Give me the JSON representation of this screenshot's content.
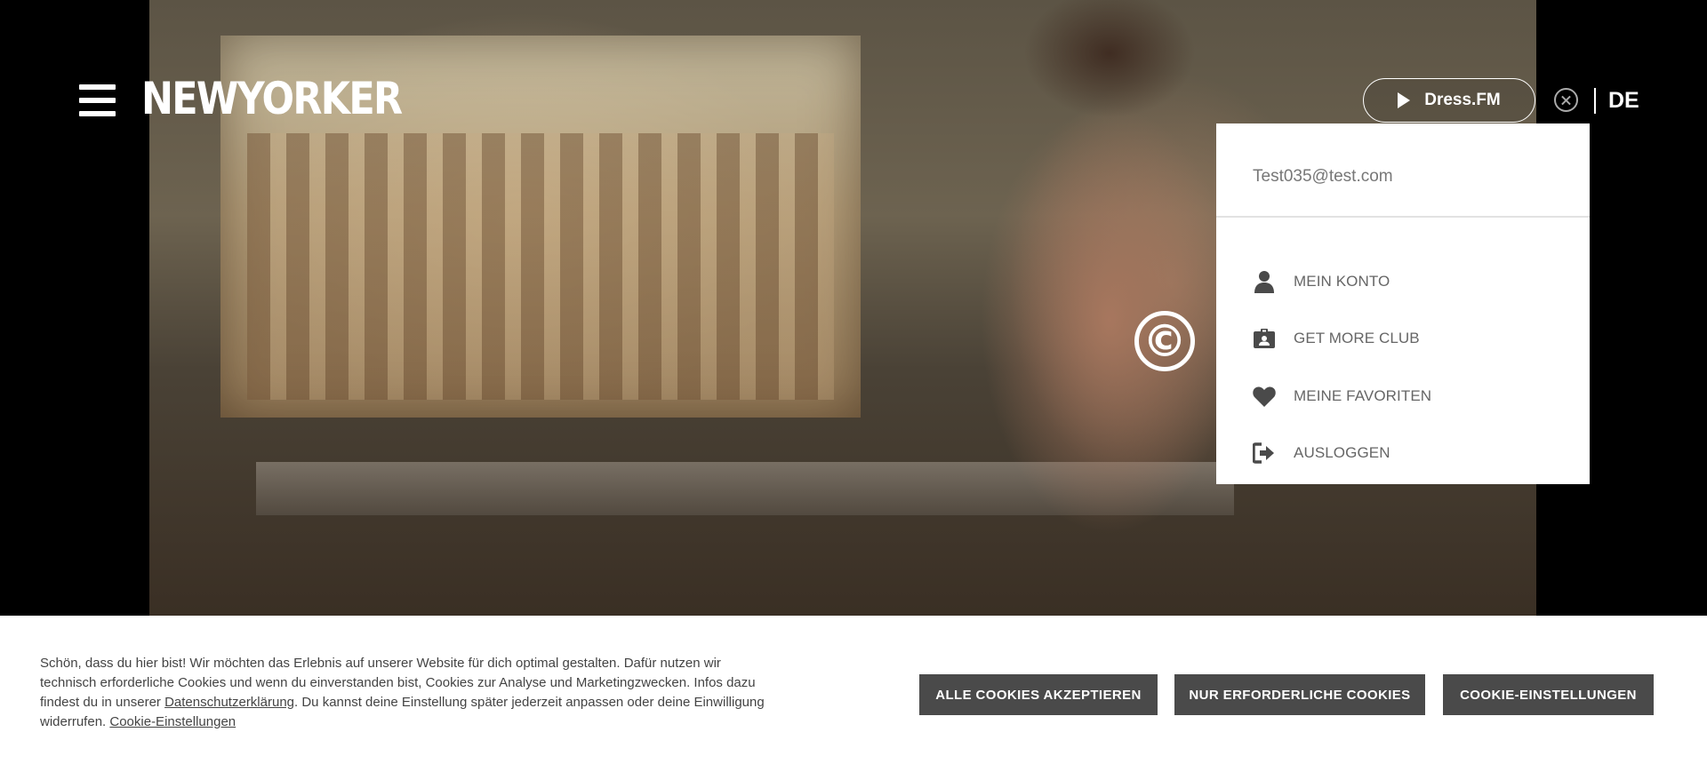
{
  "header": {
    "logo_text": "NEWYORKER",
    "dressfm_label": "Dress.FM",
    "language": "DE",
    "icons": {
      "menu": "hamburger-menu-icon",
      "play": "play-icon",
      "close": "close-circle-icon"
    }
  },
  "hero": {
    "watermark_symbol": "©"
  },
  "account_menu": {
    "email": "Test035@test.com",
    "items": [
      {
        "label": "MEIN KONTO",
        "icon": "user-icon"
      },
      {
        "label": "GET MORE CLUB",
        "icon": "club-card-icon"
      },
      {
        "label": "MEINE FAVORITEN",
        "icon": "heart-icon"
      },
      {
        "label": "AUSLOGGEN",
        "icon": "logout-icon"
      }
    ]
  },
  "cookie_banner": {
    "text_before_link": "Schön, dass du hier bist! Wir möchten das Erlebnis auf unserer Website für dich optimal gestalten. Dafür nutzen wir technisch erforderliche Cookies und wenn du einverstanden bist, Cookies zur Analyse und Marketingzwecken. Infos dazu findest du in unserer ",
    "privacy_link": "Datenschutzerklärung",
    "text_after_link": ". Du kannst deine Einstellung später jederzeit anpassen oder deine Einwilligung widerrufen. ",
    "settings_link": "Cookie-Einstellungen",
    "buttons": {
      "accept_all": "ALLE COOKIES AKZEPTIEREN",
      "necessary_only": "NUR ERFORDERLICHE COOKIES",
      "settings": "COOKIE-EINSTELLUNGEN"
    },
    "button_color": "#4a4a4a"
  }
}
